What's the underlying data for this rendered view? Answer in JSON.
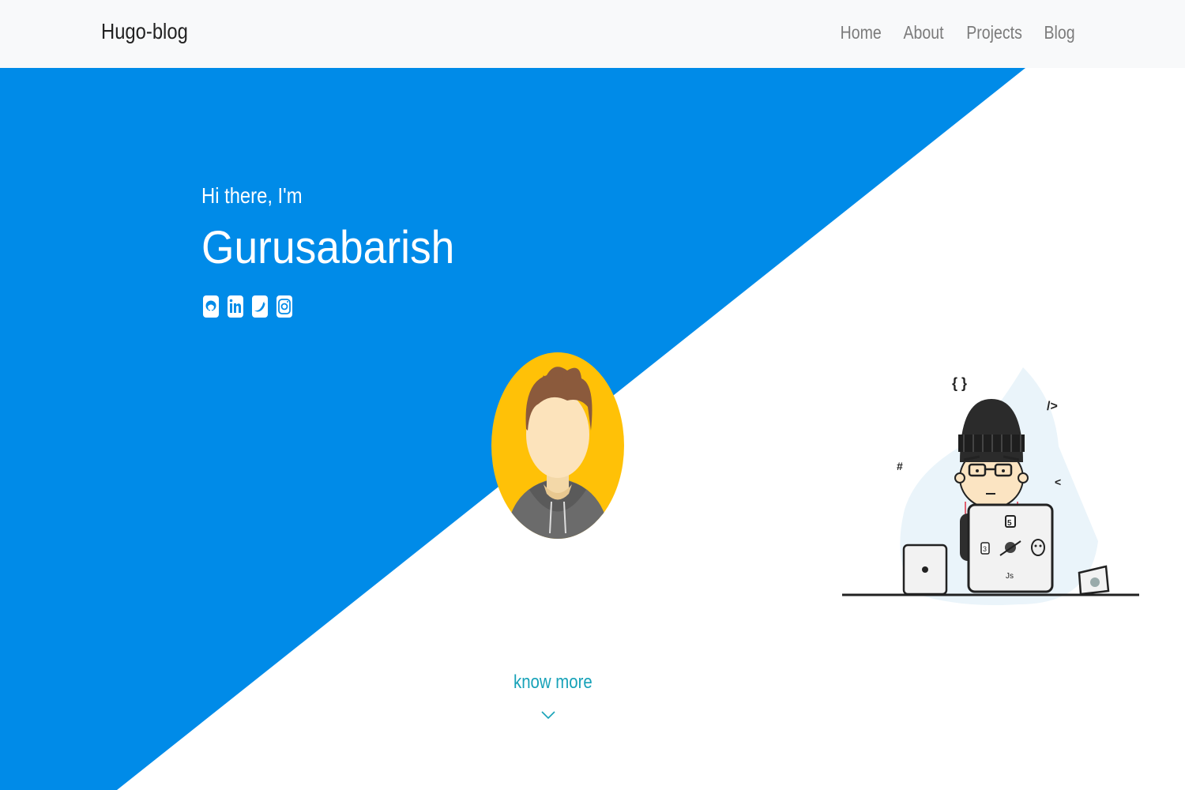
{
  "navbar": {
    "brand": "Hugo-blog",
    "links": [
      "Home",
      "About",
      "Projects",
      "Blog"
    ]
  },
  "hero": {
    "greeting": "Hi there, I'm",
    "name": "Gurusabarish",
    "socials": [
      "github-icon",
      "linkedin-icon",
      "twitter-icon",
      "instagram-icon"
    ]
  },
  "cta": {
    "label": "know more"
  },
  "colors": {
    "hero_blue": "#008be8",
    "avatar_yellow": "#ffc107",
    "accent_teal": "#17a2b8",
    "navbar_bg": "#f8f9fa"
  }
}
